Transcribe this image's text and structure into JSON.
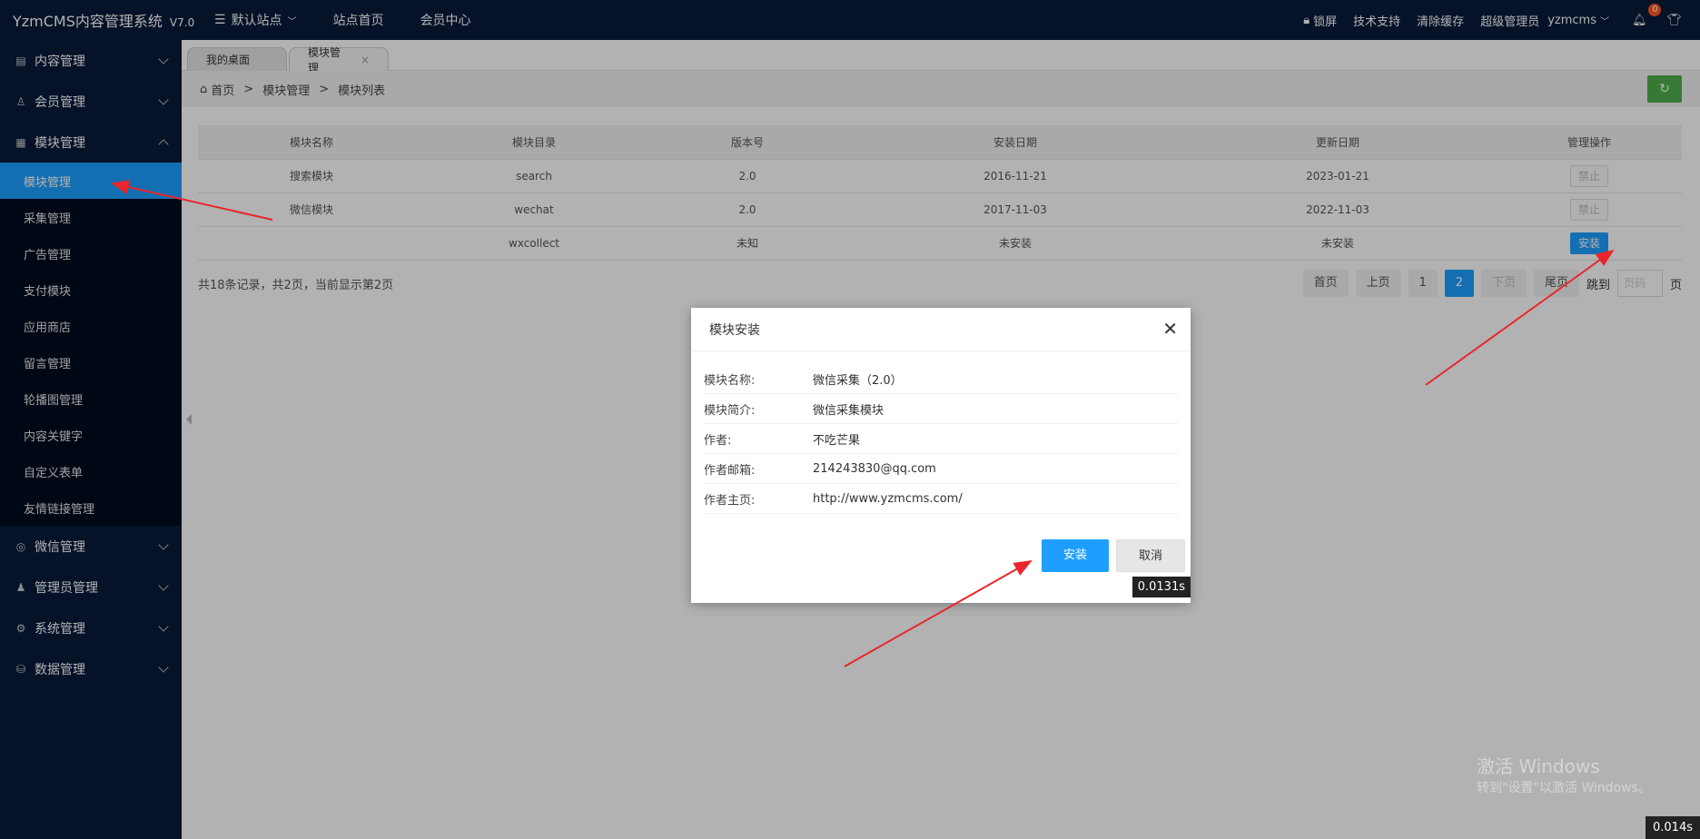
{
  "header": {
    "brand": "YzmCMS内容管理系统",
    "version": "V7.0",
    "nav": [
      "默认站点",
      "站点首页",
      "会员中心"
    ],
    "right": {
      "lock": "锁屏",
      "support": "技术支持",
      "clear_cache": "清除缓存",
      "role": "超级管理员",
      "user": "yzmcms",
      "notify_count": "0"
    }
  },
  "sidebar": {
    "groups_top": [
      {
        "label": "内容管理",
        "icon": "document-icon"
      },
      {
        "label": "会员管理",
        "icon": "user-icon"
      },
      {
        "label": "模块管理",
        "icon": "grid-icon"
      }
    ],
    "module_sub": [
      "模块管理",
      "采集管理",
      "广告管理",
      "支付模块",
      "应用商店",
      "留言管理",
      "轮播图管理",
      "内容关键字",
      "自定义表单",
      "友情链接管理"
    ],
    "groups_bottom": [
      {
        "label": "微信管理",
        "icon": "wechat-icon"
      },
      {
        "label": "管理员管理",
        "icon": "admin-icon"
      },
      {
        "label": "系统管理",
        "icon": "gear-icon"
      },
      {
        "label": "数据管理",
        "icon": "database-icon"
      }
    ]
  },
  "tabs": [
    {
      "label": "我的桌面"
    },
    {
      "label": "模块管理",
      "close": "×"
    }
  ],
  "breadcrumb": [
    "首页",
    "模块管理",
    "模块列表"
  ],
  "table": {
    "headers": [
      "模块名称",
      "模块目录",
      "版本号",
      "安装日期",
      "更新日期",
      "管理操作"
    ],
    "rows": [
      {
        "name": "搜索模块",
        "dir": "search",
        "ver": "2.0",
        "install": "2016-11-21",
        "update": "2023-01-21",
        "action": "禁止"
      },
      {
        "name": "微信模块",
        "dir": "wechat",
        "ver": "2.0",
        "install": "2017-11-03",
        "update": "2022-11-03",
        "action": "禁止"
      },
      {
        "name": "",
        "dir": "wxcollect",
        "ver": "未知",
        "install": "未安装",
        "update": "未安装",
        "action": "安装"
      }
    ]
  },
  "pageinfo": "共18条记录，共2页，当前显示第2页",
  "pager": {
    "first": "首页",
    "prev": "上页",
    "p1": "1",
    "p2": "2",
    "next": "下页",
    "last": "尾页",
    "jump": "跳到",
    "placeholder": "页码",
    "suffix": "页"
  },
  "modal": {
    "title": "模块安装",
    "rows": [
      {
        "k": "模块名称:",
        "v": "微信采集（2.0）"
      },
      {
        "k": "模块简介:",
        "v": "微信采集模块"
      },
      {
        "k": "作者:",
        "v": "不吃芒果"
      },
      {
        "k": "作者邮箱:",
        "v": "214243830@qq.com"
      },
      {
        "k": "作者主页:",
        "v": "http://www.yzmcms.com/"
      }
    ],
    "install": "安装",
    "cancel": "取消",
    "timer": "0.0131s"
  },
  "timer_bottom": "0.014s",
  "watermark": {
    "l1": "激活 Windows",
    "l2": "转到\"设置\"以激活 Windows。"
  },
  "colors": {
    "nav_bg": "#081b3a",
    "accent": "#1e9fff",
    "refresh": "#4cae4c",
    "arrow": "#e8262b"
  }
}
